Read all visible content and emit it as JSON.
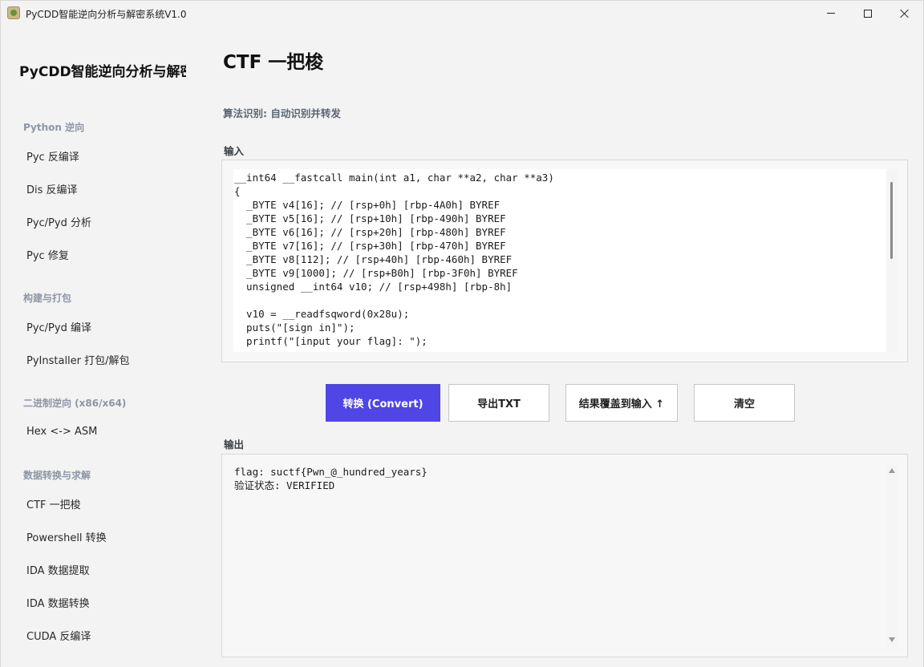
{
  "window": {
    "title": "PyCDD智能逆向分析与解密系统V1.0"
  },
  "sidebar": {
    "app_title": "PyCDD智能逆向分析与解密",
    "sections": [
      {
        "header": "Python 逆向",
        "items": [
          "Pyc 反编译",
          "Dis 反编译",
          "Pyc/Pyd 分析",
          "Pyc 修复"
        ]
      },
      {
        "header": "构建与打包",
        "items": [
          "Pyc/Pyd 编译",
          "PyInstaller 打包/解包"
        ]
      },
      {
        "header": "二进制逆向 (x86/x64)",
        "items": [
          "Hex <-> ASM"
        ]
      },
      {
        "header": "数据转换与求解",
        "items": [
          "CTF 一把梭",
          "Powershell 转换",
          "IDA 数据提取",
          "IDA 数据转换",
          "CUDA 反编译"
        ]
      }
    ]
  },
  "main": {
    "page_title": "CTF 一把梭",
    "algo_label": "算法识别: 自动识别并转发",
    "input_label": "输入",
    "input_text": "__int64 __fastcall main(int a1, char **a2, char **a3)\n{\n  _BYTE v4[16]; // [rsp+0h] [rbp-4A0h] BYREF\n  _BYTE v5[16]; // [rsp+10h] [rbp-490h] BYREF\n  _BYTE v6[16]; // [rsp+20h] [rbp-480h] BYREF\n  _BYTE v7[16]; // [rsp+30h] [rbp-470h] BYREF\n  _BYTE v8[112]; // [rsp+40h] [rbp-460h] BYREF\n  _BYTE v9[1000]; // [rsp+B0h] [rbp-3F0h] BYREF\n  unsigned __int64 v10; // [rsp+498h] [rbp-8h]\n\n  v10 = __readfsqword(0x28u);\n  puts(\"[sign in]\");\n  printf(\"[input your flag]: \");",
    "buttons": {
      "convert": "转换 (Convert)",
      "export": "导出TXT",
      "overwrite": "结果覆盖到输入 ↑",
      "clear": "清空"
    },
    "output_label": "输出",
    "output_text": "flag: suctf{Pwn_@_hundred_years}\n验证状态: VERIFIED"
  },
  "colors": {
    "accent": "#4f46e5",
    "background": "#f3f3f3",
    "section_header": "#8e96a5"
  }
}
